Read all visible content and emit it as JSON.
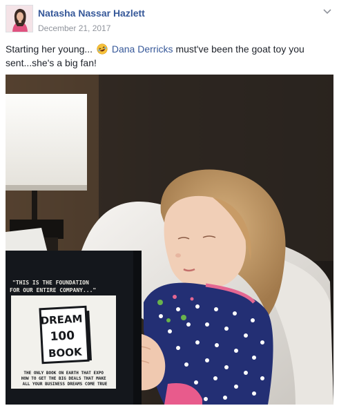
{
  "post": {
    "author": "Natasha Nassar Hazlett",
    "date": "December 21, 2017",
    "text_before": "Starting her young...",
    "emoji": "rolling-on-floor-laughing",
    "mention": "Dana Derricks",
    "text_after": "must've been the goat toy you sent...she's a big fan!"
  },
  "photo": {
    "book_tagline": "\"THIS IS THE FOUNDATION FOR OUR ENTIRE COMPANY...\"",
    "book_title_lines": [
      "DREAM",
      "100",
      "BOOK"
    ],
    "book_subtitle_lines": [
      "THE ONLY BOOK ON EARTH THAT EXPO",
      "HOW TO GET THE BIG DEALS THAT MAKE",
      "ALL YOUR BUSINESS DREAMS COME TRUE"
    ]
  },
  "icons": {
    "menu": "chevron-down-icon",
    "emoji": "rolling-laughing-emoji-icon"
  },
  "colors": {
    "author_link": "#365899",
    "meta_gray": "#90949c",
    "text": "#1d2129"
  }
}
